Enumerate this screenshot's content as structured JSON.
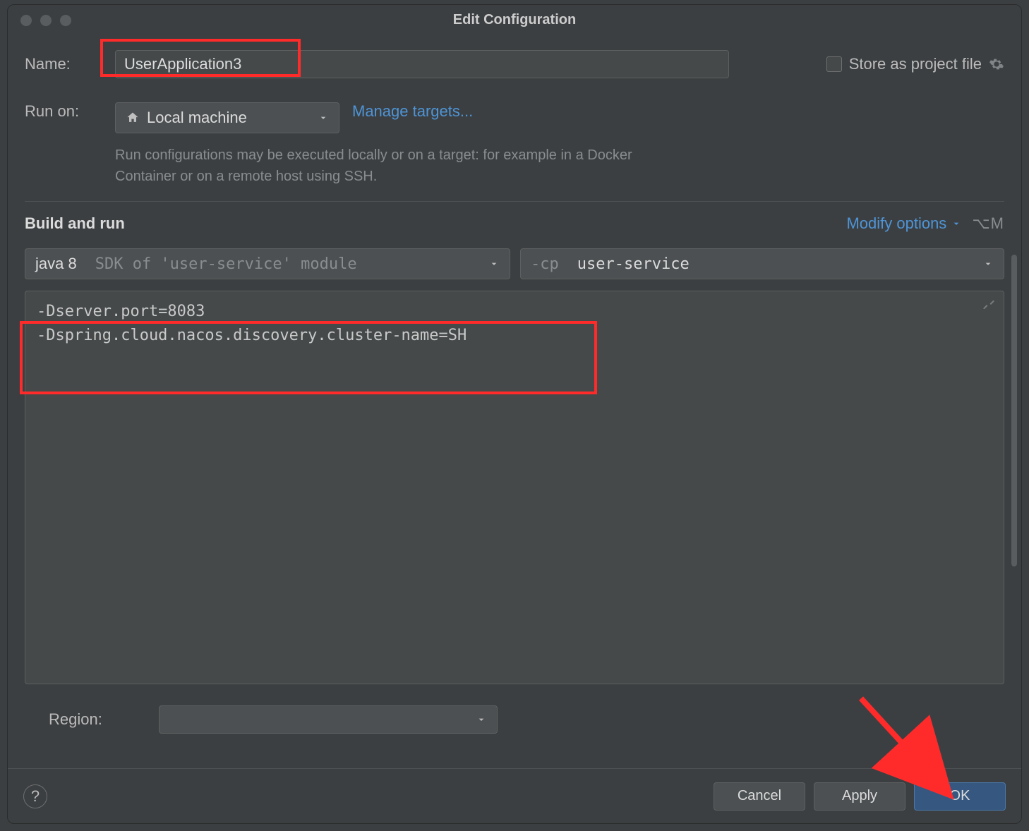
{
  "title": "Edit Configuration",
  "fields": {
    "name_label": "Name:",
    "name_value": "UserApplication3",
    "store_label": "Store as project file",
    "run_on_label": "Run on:",
    "run_on_value": "Local machine",
    "manage_targets": "Manage targets...",
    "hint": "Run configurations may be executed locally or on a target: for example in a Docker Container or on a remote host using SSH.",
    "build_title": "Build and run",
    "modify_label": "Modify options",
    "modify_shortcut": "⌥M",
    "sdk_prefix": "java 8",
    "sdk_hint": "SDK of 'user-service' module",
    "cp_prefix": "-cp",
    "cp_value": "user-service",
    "vmopts": "-Dserver.port=8083\n-Dspring.cloud.nacos.discovery.cluster-name=SH",
    "region_label": "Region:"
  },
  "buttons": {
    "cancel": "Cancel",
    "apply": "Apply",
    "ok": "OK"
  }
}
